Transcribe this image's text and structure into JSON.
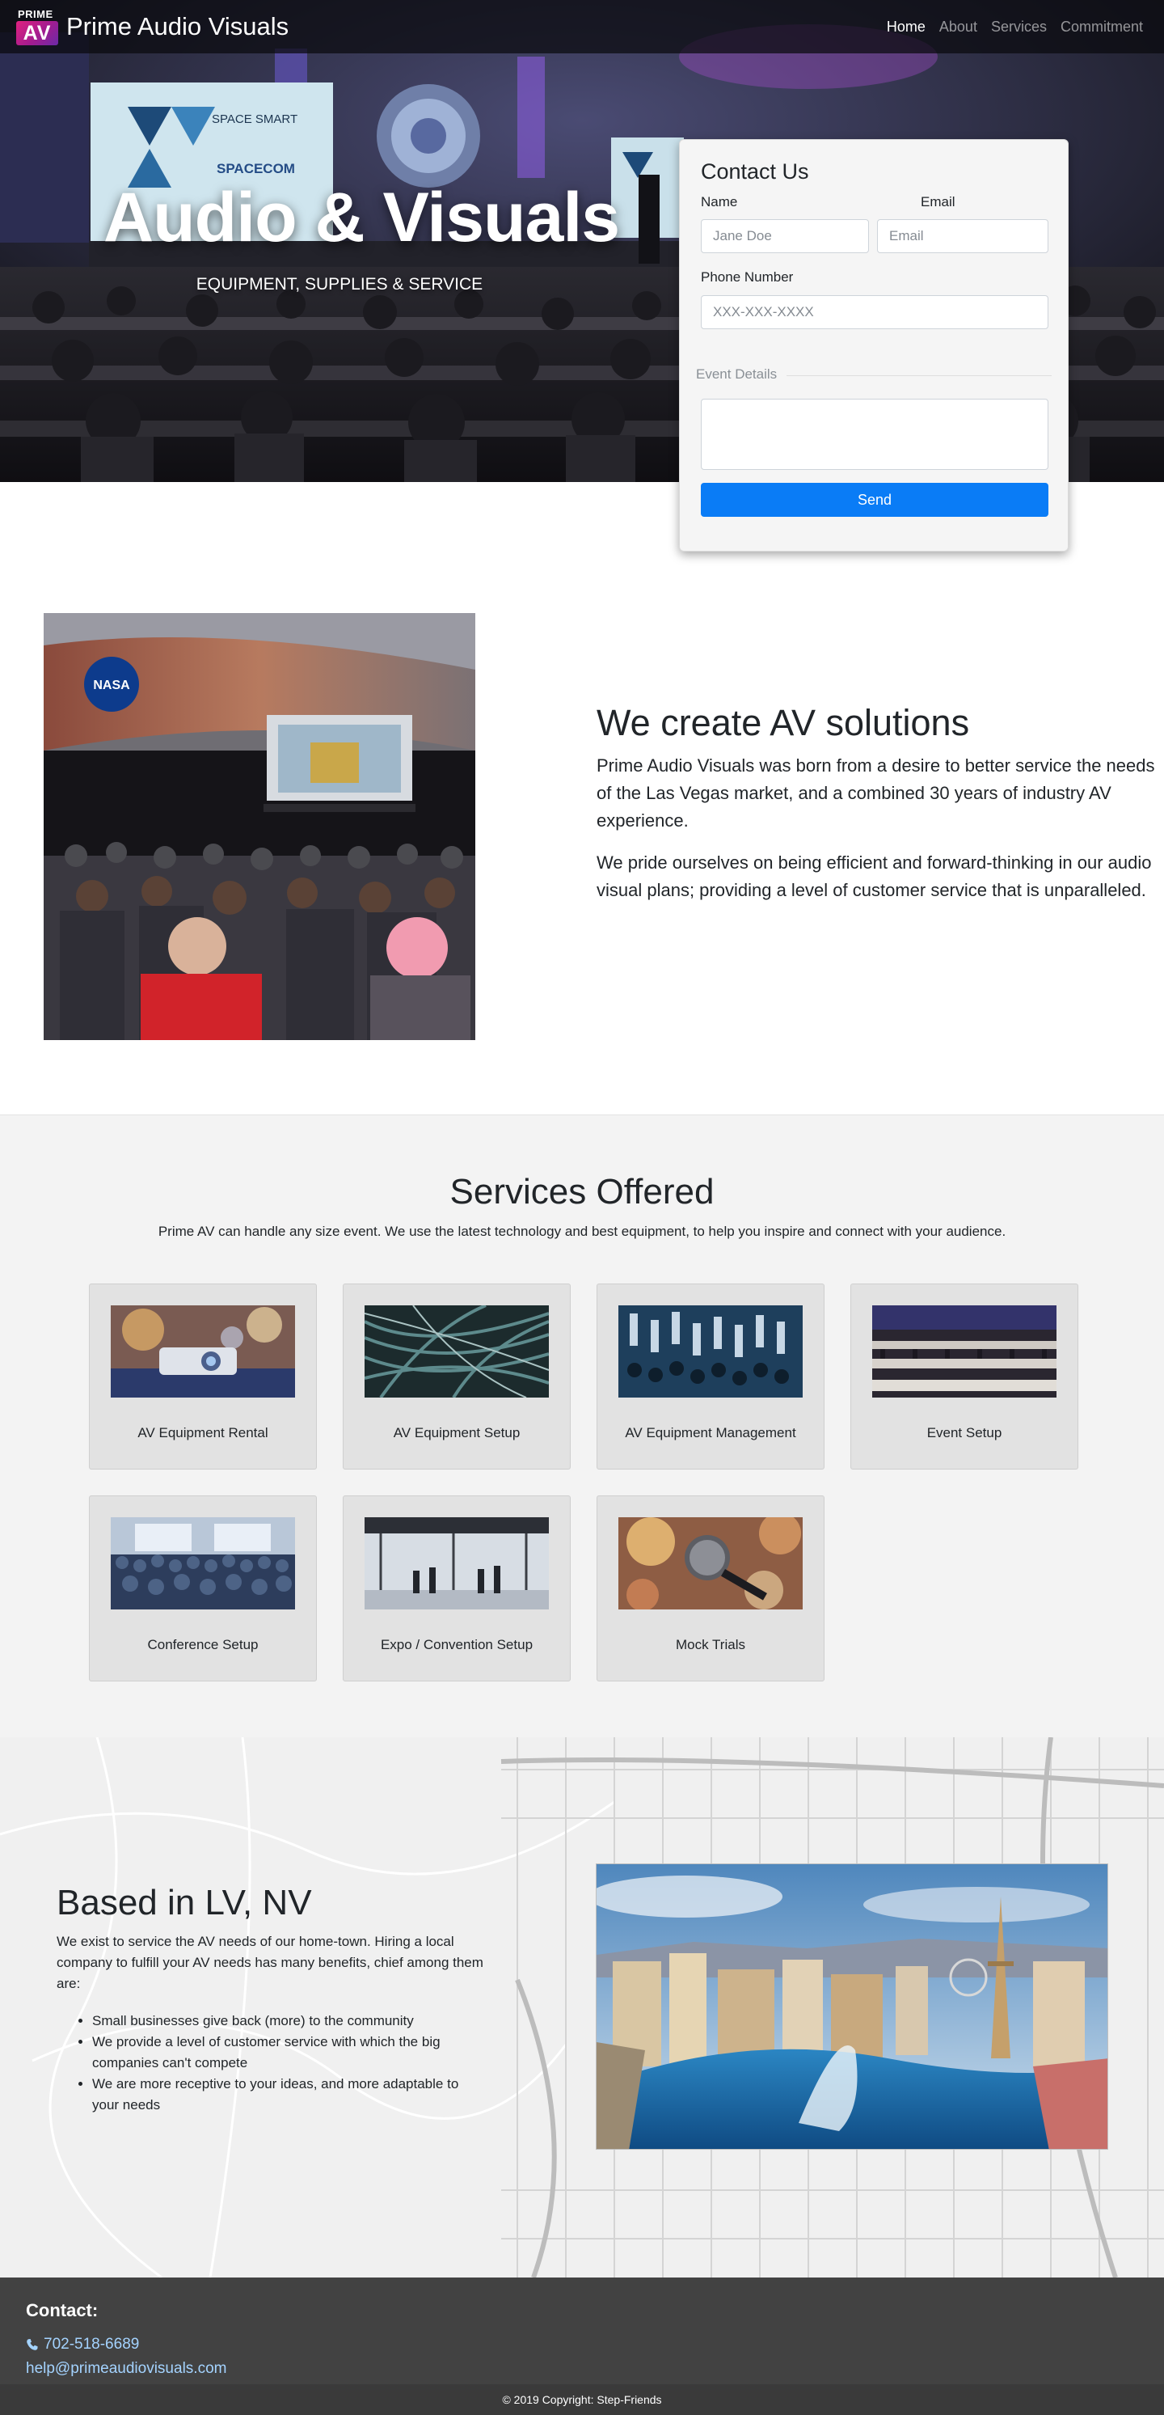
{
  "navbar": {
    "logo_top": "PRIME",
    "logo_mark": "AV",
    "brand_name": "Prime Audio Visuals",
    "links": [
      {
        "label": "Home",
        "active": true
      },
      {
        "label": "About",
        "active": false
      },
      {
        "label": "Services",
        "active": false
      },
      {
        "label": "Commitment",
        "active": false
      }
    ]
  },
  "hero": {
    "title": "Audio & Visuals",
    "subtitle": "EQUIPMENT, SUPPLIES & SERVICE",
    "screen_text_1": "SPACE SMART",
    "screen_text_2": "SPACECOM"
  },
  "contact_form": {
    "title": "Contact Us",
    "name_label": "Name",
    "name_placeholder": "Jane Doe",
    "email_label": "Email",
    "email_placeholder": "Email",
    "phone_label": "Phone Number",
    "phone_placeholder": "XXX-XXX-XXXX",
    "details_legend": "Event Details",
    "details_value": "",
    "send_label": "Send"
  },
  "about": {
    "heading": "We create AV solutions",
    "paragraphs": [
      "Prime Audio Visuals was born from a desire to better service the needs of the Las Vegas market, and a combined 30 years of industry AV experience.",
      "We pride ourselves on being efficient and forward-thinking in our audio visual plans; providing a level of customer service that is unparalleled."
    ],
    "photo_badge": "NASA"
  },
  "services": {
    "title": "Services Offered",
    "intro": "Prime AV can handle any size event. We use the latest technology and best equipment, to help you inspire and connect with your audience.",
    "items": [
      {
        "label": "AV Equipment Rental",
        "image": "projector"
      },
      {
        "label": "AV Equipment Setup",
        "image": "cables"
      },
      {
        "label": "AV Equipment Management",
        "image": "mixer"
      },
      {
        "label": "Event Setup",
        "image": "banquet-hall"
      },
      {
        "label": "Conference Setup",
        "image": "conference-audience"
      },
      {
        "label": "Expo / Convention Setup",
        "image": "expo-hall"
      },
      {
        "label": "Mock Trials",
        "image": "microphone"
      }
    ]
  },
  "location": {
    "heading": "Based in LV, NV",
    "paragraph": "We exist to service the AV needs of our home-town. Hiring a local company to fulfill your AV needs has many benefits, chief among them are:",
    "bullets": [
      "Small businesses give back (more) to the community",
      "We provide a level of customer service with which the big companies can't compete",
      "We are more receptive to your ideas, and more adaptable to your needs"
    ],
    "photo": "las-vegas-strip"
  },
  "footer": {
    "heading": "Contact:",
    "phone": "702-518-6689",
    "email": "help@primeaudiovisuals.com",
    "copyright": "© 2019 Copyright: Step-Friends"
  },
  "colors": {
    "accent": "#0a7cf6",
    "logo_gradient_start": "#e0227f",
    "logo_gradient_end": "#6b2aa8",
    "footer_bg": "#424242",
    "footer_link": "#a4d3ff",
    "services_bg": "#f3f3f3",
    "card_bg": "#e2e2e2"
  }
}
